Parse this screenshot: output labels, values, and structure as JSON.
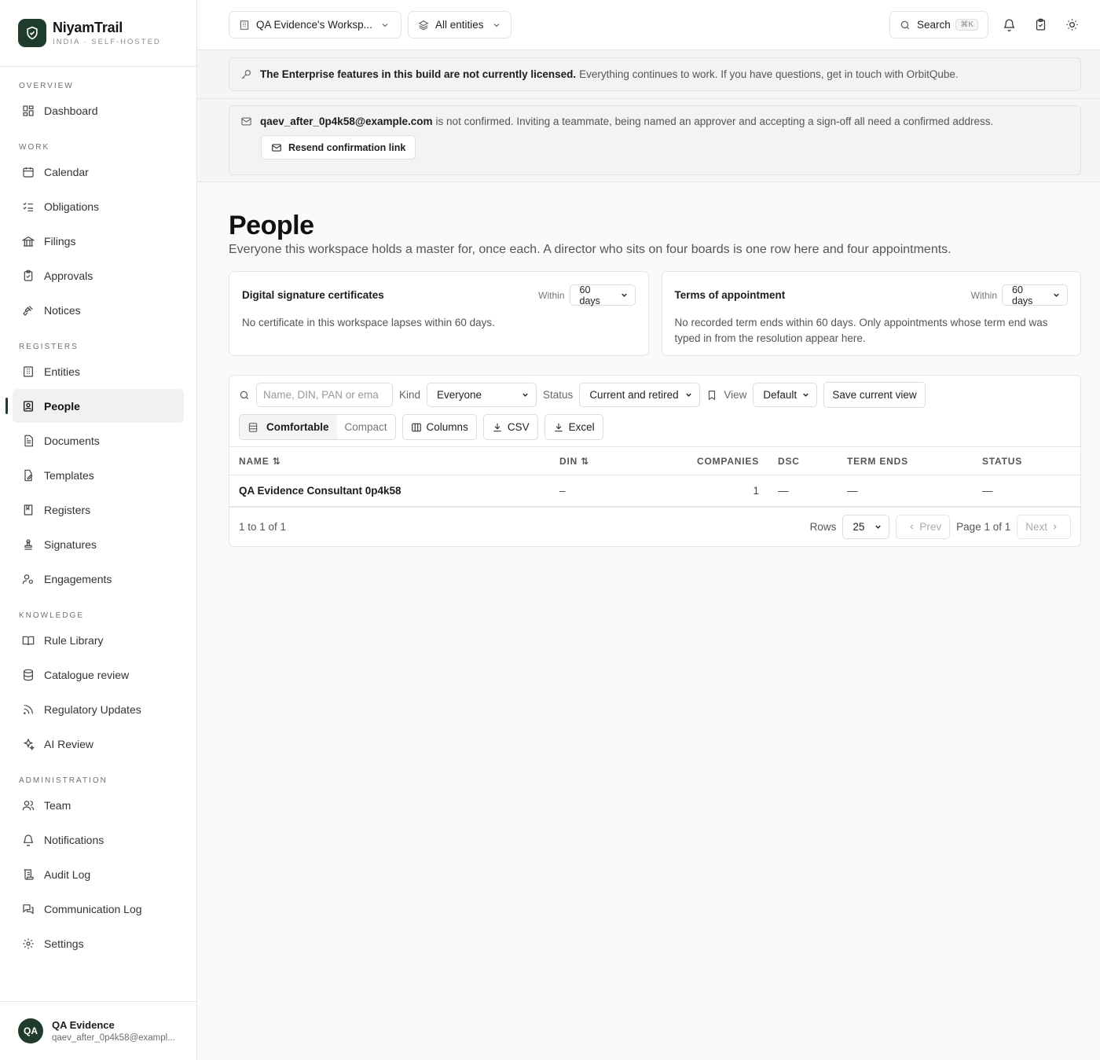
{
  "brand": {
    "name": "NiyamTrail",
    "subtitle": "INDIA · SELF-HOSTED"
  },
  "sidebar": {
    "sections": [
      {
        "label": "OVERVIEW",
        "items": [
          {
            "label": "Dashboard",
            "icon": "grid-icon"
          }
        ]
      },
      {
        "label": "WORK",
        "items": [
          {
            "label": "Calendar",
            "icon": "calendar-icon"
          },
          {
            "label": "Obligations",
            "icon": "checklist-icon"
          },
          {
            "label": "Filings",
            "icon": "landmark-icon"
          },
          {
            "label": "Approvals",
            "icon": "clipboard-check-icon"
          },
          {
            "label": "Notices",
            "icon": "gavel-icon"
          }
        ]
      },
      {
        "label": "REGISTERS",
        "items": [
          {
            "label": "Entities",
            "icon": "building-icon"
          },
          {
            "label": "People",
            "icon": "contact-icon",
            "active": true
          },
          {
            "label": "Documents",
            "icon": "file-text-icon"
          },
          {
            "label": "Templates",
            "icon": "file-edit-icon"
          },
          {
            "label": "Registers",
            "icon": "book-icon"
          },
          {
            "label": "Signatures",
            "icon": "stamp-icon"
          },
          {
            "label": "Engagements",
            "icon": "users-cog-icon"
          }
        ]
      },
      {
        "label": "KNOWLEDGE",
        "items": [
          {
            "label": "Rule Library",
            "icon": "book-open-icon"
          },
          {
            "label": "Catalogue review",
            "icon": "database-icon"
          },
          {
            "label": "Regulatory Updates",
            "icon": "rss-icon"
          },
          {
            "label": "AI Review",
            "icon": "sparkles-icon"
          }
        ]
      },
      {
        "label": "ADMINISTRATION",
        "items": [
          {
            "label": "Team",
            "icon": "users-icon"
          },
          {
            "label": "Notifications",
            "icon": "bell-icon"
          },
          {
            "label": "Audit Log",
            "icon": "scroll-icon"
          },
          {
            "label": "Communication Log",
            "icon": "messages-icon"
          },
          {
            "label": "Settings",
            "icon": "gear-icon"
          }
        ]
      }
    ]
  },
  "user": {
    "initials": "QA",
    "name": "QA Evidence",
    "email": "qaev_after_0p4k58@exampl..."
  },
  "topbar": {
    "workspace": "QA Evidence's Worksp...",
    "entities": "All entities",
    "search": "Search",
    "shortcut": "⌘K"
  },
  "license_banner": {
    "bold": "The Enterprise features in this build are not currently licensed.",
    "text": "Everything continues to work. If you have questions, get in touch with OrbitQube."
  },
  "confirm_banner": {
    "email": "qaev_after_0p4k58@example.com",
    "text": "is not confirmed. Inviting a teammate, being named an approver and accepting a sign-off all need a confirmed address.",
    "button": "Resend confirmation link"
  },
  "page": {
    "title": "People",
    "subtitle": "Everyone this workspace holds a master for, once each. A director who sits on four boards is one row here and four appointments."
  },
  "cards": [
    {
      "title": "Digital signature certificates",
      "within_label": "Within",
      "within_value": "60 days",
      "body": "No certificate in this workspace lapses within 60 days."
    },
    {
      "title": "Terms of appointment",
      "within_label": "Within",
      "within_value": "60 days",
      "body": "No recorded term ends within 60 days. Only appointments whose term end was typed in from the resolution appear here."
    }
  ],
  "filters": {
    "search_placeholder": "Name, DIN, PAN or ema",
    "kind_label": "Kind",
    "kind_value": "Everyone",
    "status_label": "Status",
    "status_value": "Current and retired",
    "view_label": "View",
    "view_value": "Default",
    "save_view": "Save current view",
    "density_comfortable": "Comfortable",
    "density_compact": "Compact",
    "columns": "Columns",
    "csv": "CSV",
    "excel": "Excel"
  },
  "table": {
    "headers": {
      "name": "NAME",
      "din": "DIN",
      "companies": "COMPANIES",
      "dsc": "DSC",
      "term_ends": "TERM ENDS",
      "status": "STATUS"
    },
    "rows": [
      {
        "name": "QA Evidence Consultant 0p4k58",
        "din": "–",
        "companies": "1",
        "dsc": "—",
        "term_ends": "—",
        "status": "—"
      }
    ]
  },
  "pagination": {
    "summary": "1 to 1 of 1",
    "rows_label": "Rows",
    "rows_value": "25",
    "prev": "Prev",
    "page": "Page 1 of 1",
    "next": "Next"
  }
}
